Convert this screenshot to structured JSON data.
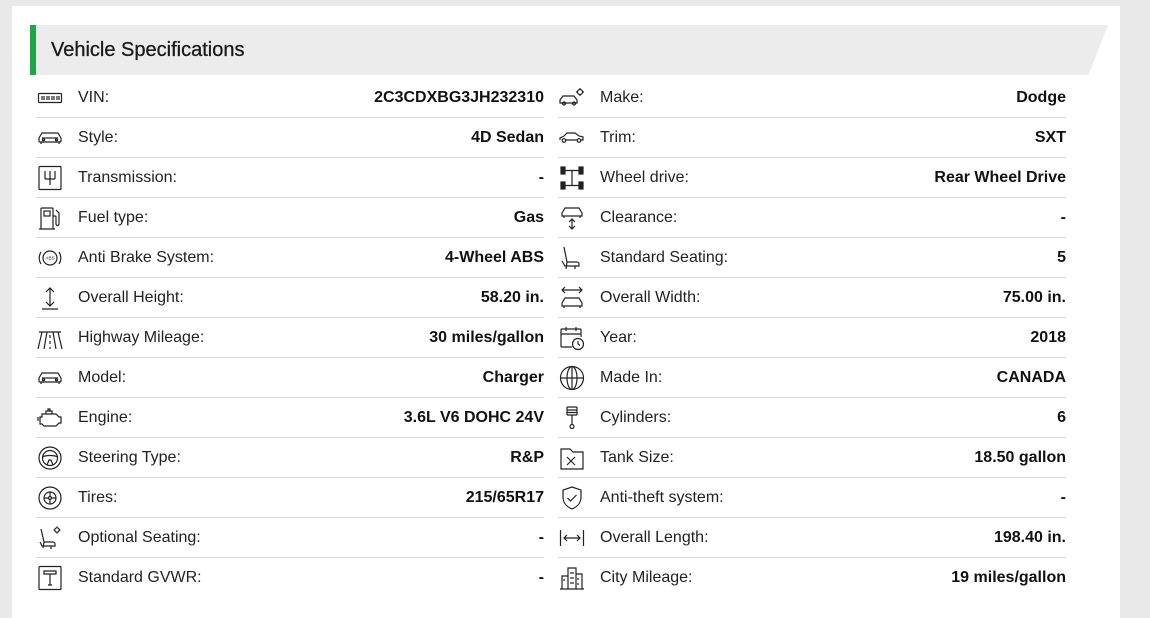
{
  "section": {
    "title": "Vehicle Specifications"
  },
  "colors": {
    "accent": "#1fa64a",
    "header_bg": "#ececec"
  },
  "left": [
    {
      "icon": "vin-icon",
      "label": "VIN:",
      "value": "2C3CDXBG3JH232310"
    },
    {
      "icon": "car-front-icon",
      "label": "Style:",
      "value": "4D Sedan"
    },
    {
      "icon": "gearshift-icon",
      "label": "Transmission:",
      "value": "-"
    },
    {
      "icon": "fuel-pump-icon",
      "label": "Fuel type:",
      "value": "Gas"
    },
    {
      "icon": "abs-icon",
      "label": "Anti Brake System:",
      "value": "4-Wheel ABS"
    },
    {
      "icon": "height-arrow-icon",
      "label": "Overall Height:",
      "value": "58.20 in."
    },
    {
      "icon": "highway-icon",
      "label": "Highway Mileage:",
      "value": "30 miles/gallon"
    },
    {
      "icon": "car-front-icon",
      "label": "Model:",
      "value": "Charger"
    },
    {
      "icon": "engine-icon",
      "label": "Engine:",
      "value": "3.6L V6 DOHC 24V"
    },
    {
      "icon": "steering-wheel-icon",
      "label": "Steering Type:",
      "value": "R&P"
    },
    {
      "icon": "tire-icon",
      "label": "Tires:",
      "value": "215/65R17"
    },
    {
      "icon": "seat-gear-icon",
      "label": "Optional Seating:",
      "value": "-"
    },
    {
      "icon": "gvwr-icon",
      "label": "Standard GVWR:",
      "value": "-"
    }
  ],
  "right": [
    {
      "icon": "car-gear-icon",
      "label": "Make:",
      "value": "Dodge"
    },
    {
      "icon": "car-side-icon",
      "label": "Trim:",
      "value": "SXT"
    },
    {
      "icon": "drivetrain-icon",
      "label": "Wheel drive:",
      "value": "Rear Wheel Drive"
    },
    {
      "icon": "clearance-icon",
      "label": "Clearance:",
      "value": "-"
    },
    {
      "icon": "seat-icon",
      "label": "Standard Seating:",
      "value": "5"
    },
    {
      "icon": "width-car-icon",
      "label": "Overall Width:",
      "value": "75.00 in."
    },
    {
      "icon": "calendar-clock-icon",
      "label": "Year:",
      "value": "2018"
    },
    {
      "icon": "globe-icon",
      "label": "Made In:",
      "value": "CANADA"
    },
    {
      "icon": "piston-icon",
      "label": "Cylinders:",
      "value": "6"
    },
    {
      "icon": "fuel-tank-icon",
      "label": "Tank Size:",
      "value": "18.50 gallon"
    },
    {
      "icon": "shield-check-icon",
      "label": "Anti-theft system:",
      "value": "-"
    },
    {
      "icon": "length-arrow-icon",
      "label": "Overall Length:",
      "value": "198.40 in."
    },
    {
      "icon": "city-buildings-icon",
      "label": "City Mileage:",
      "value": "19 miles/gallon"
    }
  ]
}
